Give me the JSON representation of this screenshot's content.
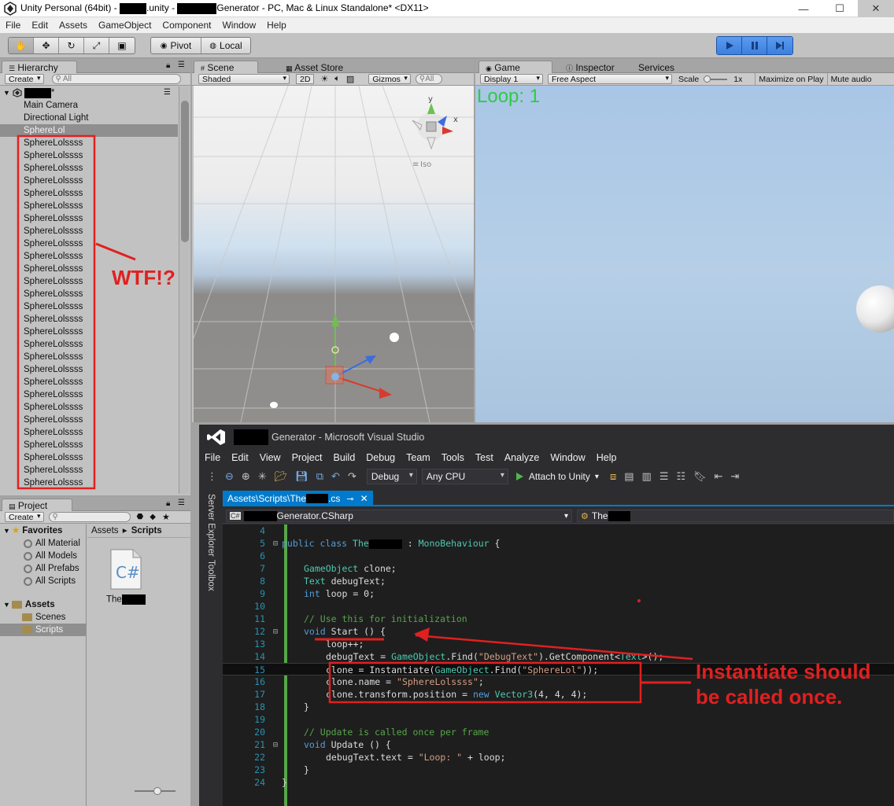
{
  "window": {
    "title_prefix": "Unity Personal (64bit) - ",
    "title_middle": ".unity - ",
    "title_suffix": "Generator - PC, Mac & Linux Standalone* <DX11>"
  },
  "menu": [
    "File",
    "Edit",
    "Assets",
    "GameObject",
    "Component",
    "Window",
    "Help"
  ],
  "toolbar": {
    "pivot_label": "Pivot",
    "local_label": "Local"
  },
  "hierarchy": {
    "tab": "Hierarchy",
    "create": "Create",
    "search_placeholder": "All",
    "root_suffix": "*",
    "items": [
      "Main Camera",
      "Directional Light",
      "SphereLol"
    ],
    "clone_name": "SphereLolssss",
    "clone_rows": 28
  },
  "project": {
    "tab": "Project",
    "create": "Create",
    "favorites": {
      "label": "Favorites",
      "items": [
        "All Material",
        "All Models",
        "All Prefabs",
        "All Scripts"
      ]
    },
    "assets": {
      "label": "Assets",
      "items": [
        "Scenes",
        "Scripts"
      ]
    },
    "breadcrumb": [
      "Assets",
      "Scripts"
    ],
    "file_label": "The"
  },
  "scene": {
    "tabs": [
      "Scene",
      "Asset Store"
    ],
    "shading": "Shaded",
    "mode_2d": "2D",
    "gizmos": "Gizmos",
    "search_placeholder": "All",
    "gizmo_y": "y",
    "gizmo_x": "x",
    "iso": "Iso"
  },
  "game": {
    "tabs": [
      "Game",
      "Inspector",
      "Services"
    ],
    "display": "Display 1",
    "aspect": "Free Aspect",
    "scale_label": "Scale",
    "scale_value": "1x",
    "maximize": "Maximize on Play",
    "mute": "Mute audio",
    "loop_text": "Loop: 1"
  },
  "vs": {
    "title_suffix": "Generator - Microsoft Visual Studio",
    "menu": [
      "File",
      "Edit",
      "View",
      "Project",
      "Build",
      "Debug",
      "Team",
      "Tools",
      "Test",
      "Analyze",
      "Window",
      "Help"
    ],
    "config": "Debug",
    "platform": "Any CPU",
    "attach": "Attach to Unity",
    "side": [
      "Server Explorer",
      "Toolbox"
    ],
    "file_tab_prefix": "Assets\\Scripts\\The",
    "file_tab_suffix": ".cs",
    "nav_left_suffix": "Generator.CSharp",
    "nav_right_prefix": "The"
  },
  "annotations": {
    "wtf": "WTF!?",
    "note_line1": "Instantiate should",
    "note_line2": "be called once."
  },
  "colors": {
    "annotation_red": "#e02020",
    "loop_green": "#2ecc40",
    "vs_accent": "#007acc"
  }
}
